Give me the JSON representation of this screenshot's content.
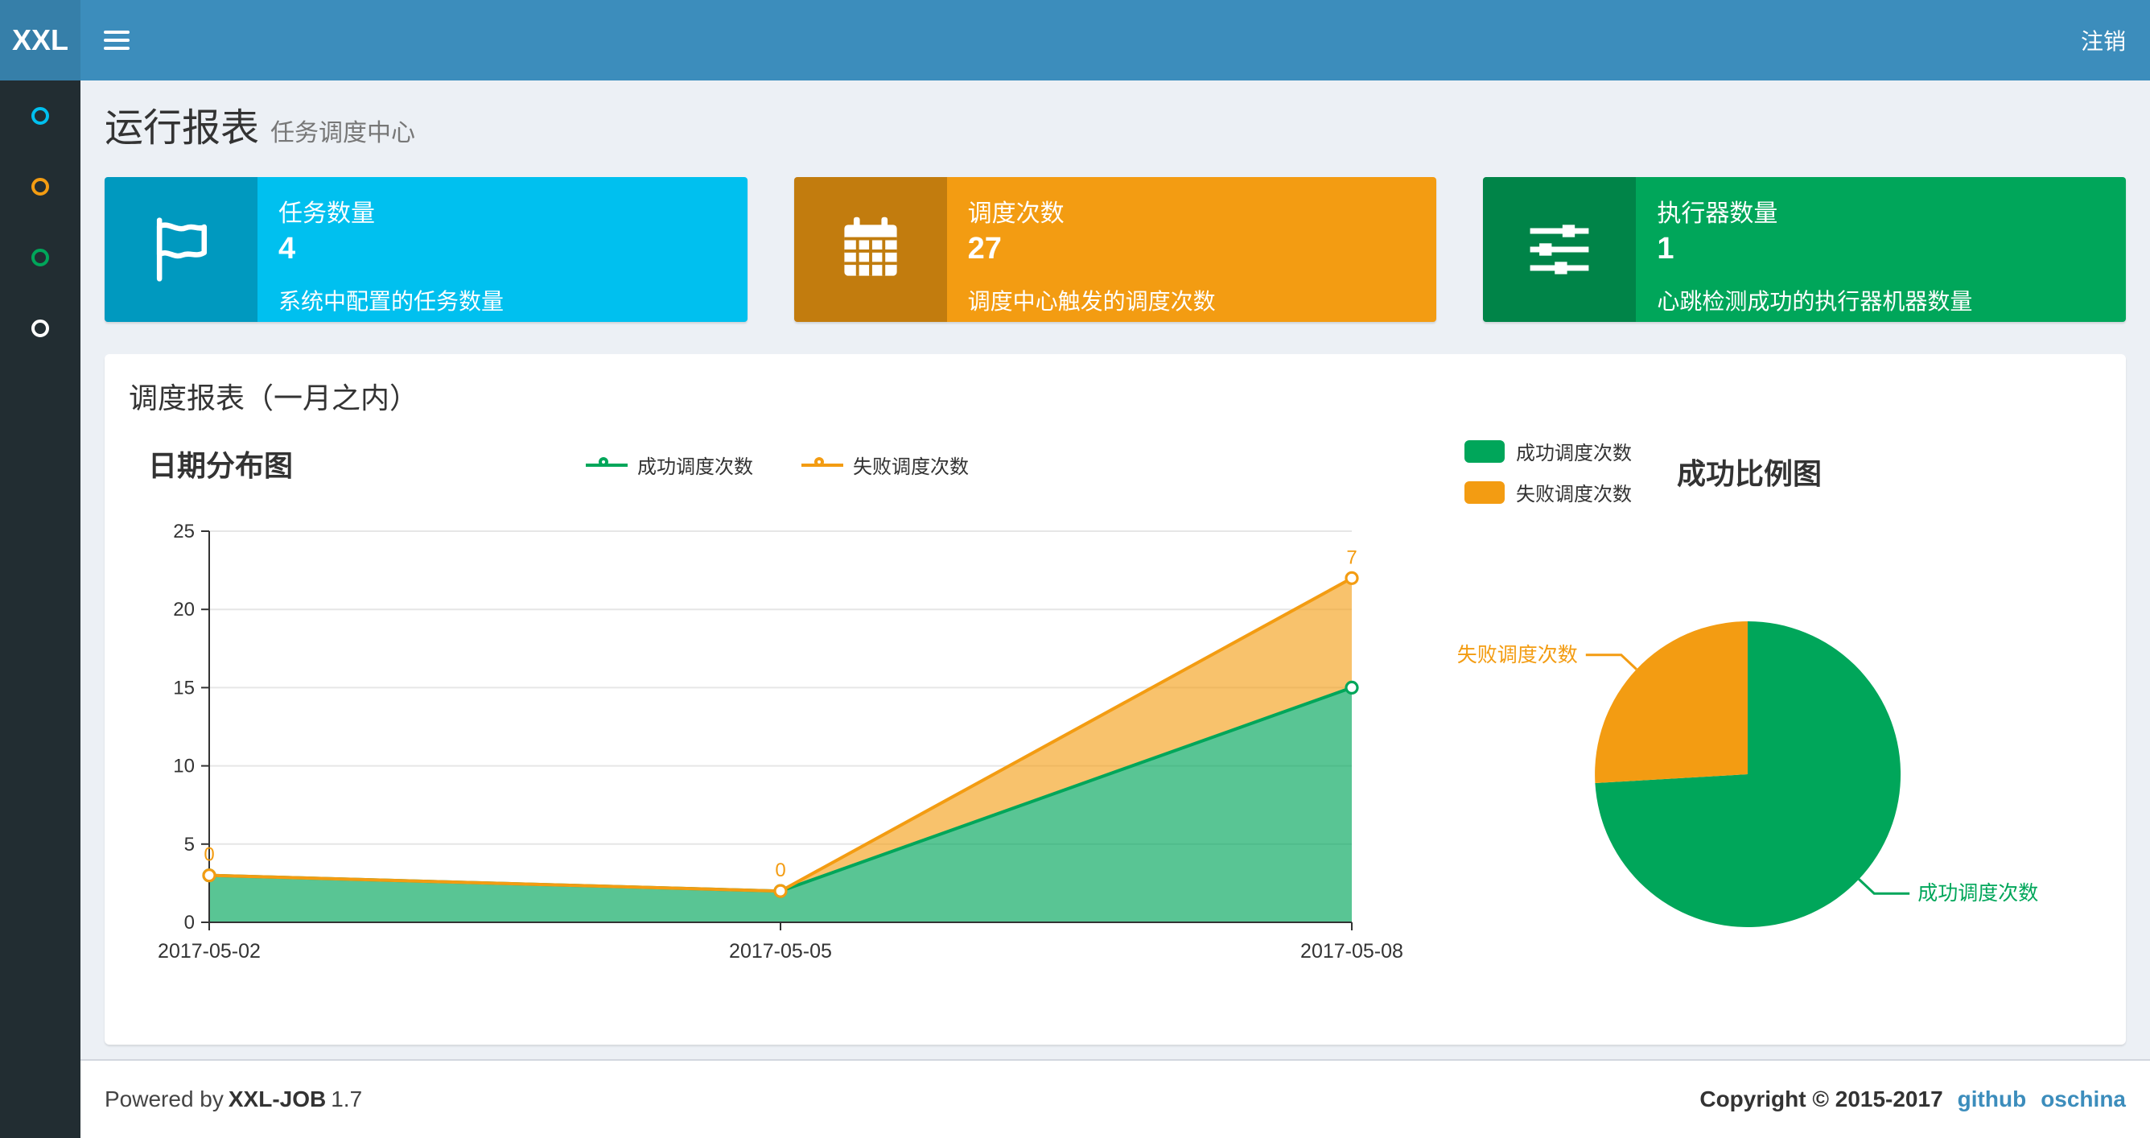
{
  "navbar": {
    "logo_text": "XXL",
    "logout_label": "注销"
  },
  "sidebar": {
    "items": [
      {
        "icon": "circle-icon",
        "color": "#00c0ef"
      },
      {
        "icon": "circle-icon",
        "color": "#f39c12"
      },
      {
        "icon": "circle-icon",
        "color": "#00a65a"
      },
      {
        "icon": "circle-icon",
        "color": "#ffffff"
      }
    ]
  },
  "header": {
    "title": "运行报表",
    "subtitle": "任务调度中心"
  },
  "info_boxes": [
    {
      "label": "任务数量",
      "value": "4",
      "desc": "系统中配置的任务数量",
      "color": "#00c0ef",
      "icon": "flag-icon"
    },
    {
      "label": "调度次数",
      "value": "27",
      "desc": "调度中心触发的调度次数",
      "color": "#f39c12",
      "icon": "calendar-icon"
    },
    {
      "label": "执行器数量",
      "value": "1",
      "desc": "心跳检测成功的执行器机器数量",
      "color": "#00a65a",
      "icon": "sliders-icon"
    }
  ],
  "panel": {
    "title": "调度报表（一月之内）"
  },
  "chart_data": [
    {
      "type": "area",
      "title": "日期分布图",
      "x": [
        "2017-05-02",
        "2017-05-05",
        "2017-05-08"
      ],
      "series": [
        {
          "name": "成功调度次数",
          "values": [
            3,
            2,
            15
          ],
          "color": "#00a65a"
        },
        {
          "name": "失败调度次数",
          "values": [
            0,
            0,
            7
          ],
          "color": "#f39c12"
        }
      ],
      "stacked": true,
      "ylim": [
        0,
        25
      ],
      "yticks": [
        0,
        5,
        10,
        15,
        20,
        25
      ],
      "point_labels": {
        "series": "失败调度次数",
        "values": [
          "0",
          "0",
          "7"
        ]
      },
      "legend_position": "top-center",
      "grid": true
    },
    {
      "type": "pie",
      "title": "成功比例图",
      "slices": [
        {
          "name": "成功调度次数",
          "value": 20,
          "color": "#00a65a"
        },
        {
          "name": "失败调度次数",
          "value": 7,
          "color": "#f39c12"
        }
      ],
      "legend_position": "top-left",
      "start_angle_deg": 0,
      "direction": "clockwise"
    }
  ],
  "footer": {
    "powered_prefix": "Powered by",
    "product": "XXL-JOB",
    "version": "1.7",
    "copyright": "Copyright © 2015-2017",
    "links": [
      {
        "label": "github"
      },
      {
        "label": "oschina"
      }
    ]
  },
  "colors": {
    "navbar_bg": "#3c8dbc",
    "logo_bg": "#367fa9",
    "sidebar_bg": "#222d32",
    "content_bg": "#ecf0f5",
    "link": "#3c8dbc"
  }
}
